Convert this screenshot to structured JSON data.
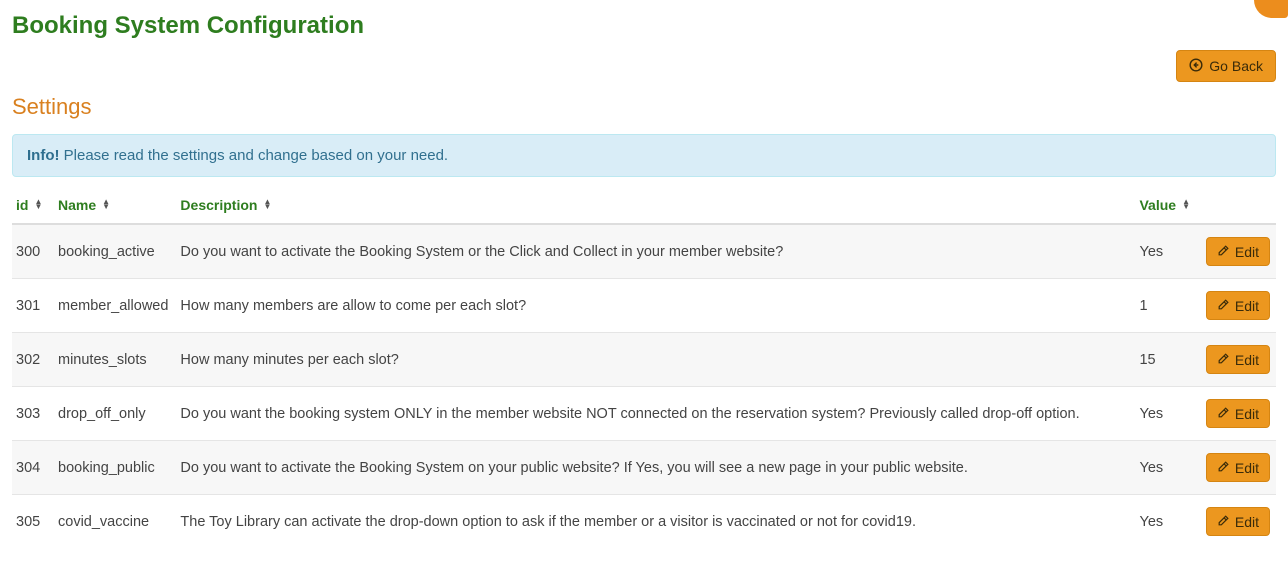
{
  "page_title": "Booking System Configuration",
  "go_back_label": "Go Back",
  "section_title": "Settings",
  "info_label": "Info!",
  "info_text": "Please read the settings and change based on your need.",
  "edit_label": "Edit",
  "columns": {
    "id": "id",
    "name": "Name",
    "description": "Description",
    "value": "Value"
  },
  "rows": [
    {
      "id": "300",
      "name": "booking_active",
      "description": "Do you want to activate the Booking System or the Click and Collect in your member website?",
      "value": "Yes"
    },
    {
      "id": "301",
      "name": "member_allowed",
      "description": "How many members are allow to come per each slot?",
      "value": "1"
    },
    {
      "id": "302",
      "name": "minutes_slots",
      "description": "How many minutes per each slot?",
      "value": "15"
    },
    {
      "id": "303",
      "name": "drop_off_only",
      "description": "Do you want the booking system ONLY in the member website NOT connected on the reservation system? Previously called drop-off option.",
      "value": "Yes"
    },
    {
      "id": "304",
      "name": "booking_public",
      "description": "Do you want to activate the Booking System on your public website? If Yes, you will see a new page in your public website.",
      "value": "Yes"
    },
    {
      "id": "305",
      "name": "covid_vaccine",
      "description": "The Toy Library can activate the drop-down option to ask if the member or a visitor is vaccinated or not for covid19.",
      "value": "Yes"
    }
  ]
}
